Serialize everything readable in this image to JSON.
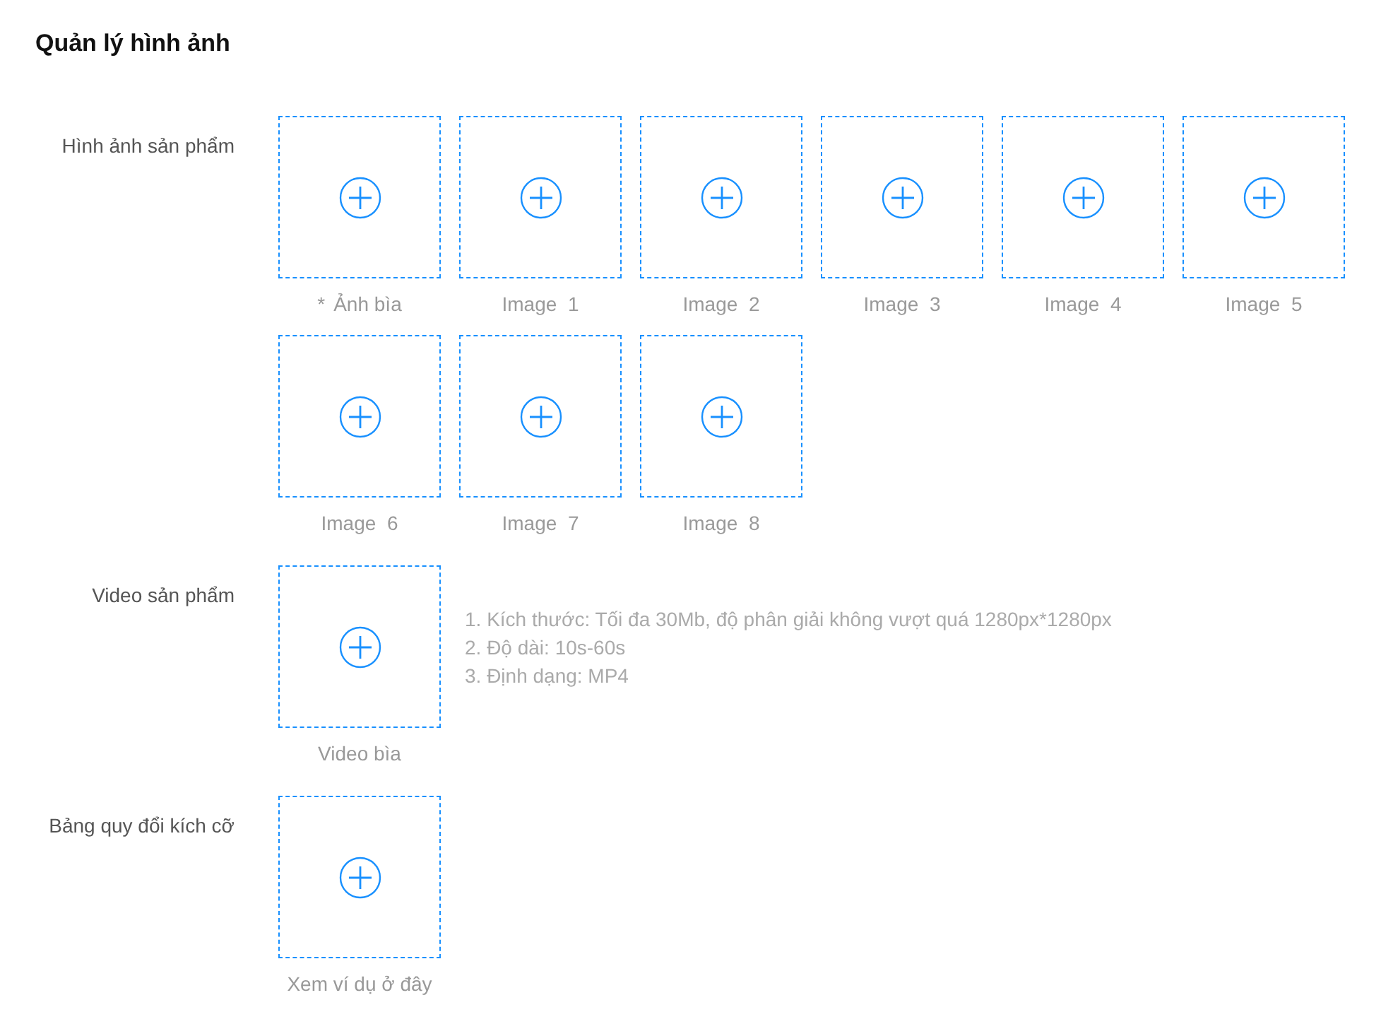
{
  "title": "Quản lý hình ảnh",
  "sections": [
    {
      "label": "Hình ảnh sản phẩm",
      "items": [
        {
          "caption": "Ảnh bìa",
          "mark": "*"
        },
        {
          "caption": "Image  1"
        },
        {
          "caption": "Image  2"
        },
        {
          "caption": "Image  3"
        },
        {
          "caption": "Image  4"
        },
        {
          "caption": "Image  5"
        },
        {
          "caption": "Image  6"
        },
        {
          "caption": "Image  7"
        },
        {
          "caption": "Image  8"
        }
      ]
    },
    {
      "label": "Video sản phẩm",
      "items": [
        {
          "caption": "Video bìa"
        }
      ],
      "hints": [
        "1. Kích thước: Tối đa 30Mb, độ phân giải không vượt quá 1280px*1280px",
        "2. Độ dài: 10s-60s",
        "3. Định dạng: MP4"
      ]
    },
    {
      "label": "Bảng quy đổi kích cỡ",
      "items": [
        {
          "caption": "Xem ví dụ ở đây"
        }
      ]
    }
  ]
}
